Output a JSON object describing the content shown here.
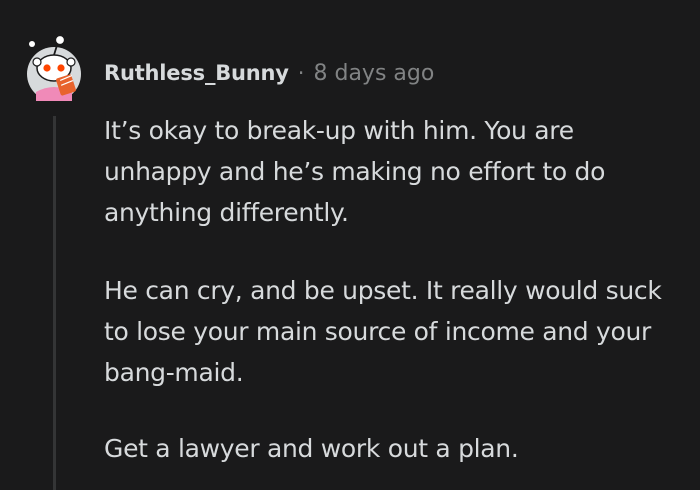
{
  "comment": {
    "author": "Ruthless_Bunny",
    "separator": "·",
    "timestamp": "8 days ago",
    "avatar_icon": "snoo-avatar-reading-book-icon",
    "paragraphs": [
      "It’s okay to break-up with him. You are unhappy and he’s making no effort to do anything differently.",
      "He can cry, and be upset. It really would suck to lose your main source of income and your bang-maid.",
      "Get a lawyer and work out a plan."
    ]
  },
  "colors": {
    "background": "#1a1a1b",
    "text": "#d7dadc",
    "meta_text": "#818384",
    "thread_line": "#343536",
    "avatar_accent": "#ff4500",
    "avatar_book": "#e8632d",
    "avatar_shirt": "#f08ab8"
  }
}
